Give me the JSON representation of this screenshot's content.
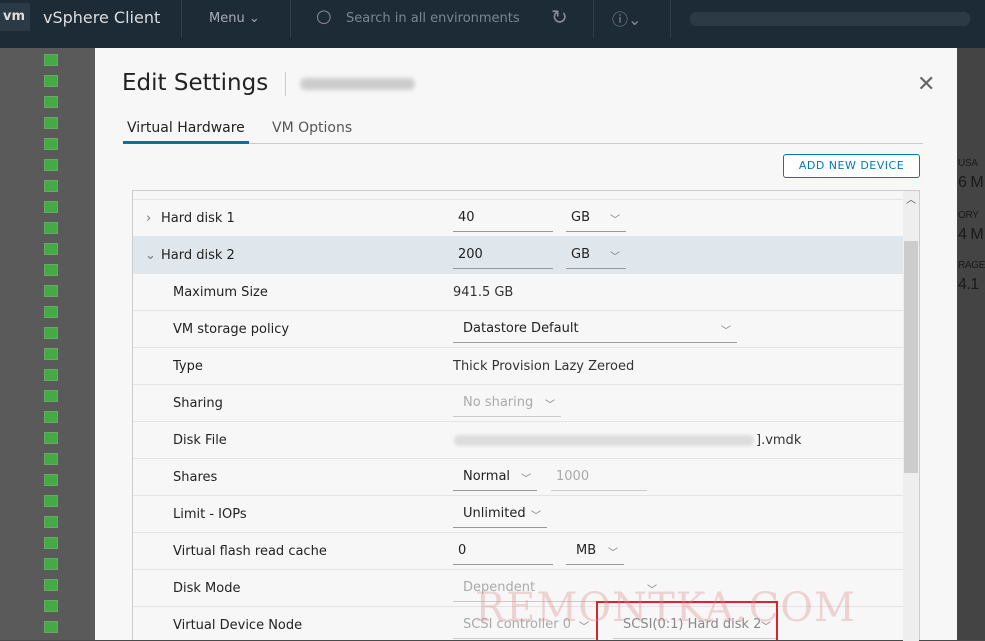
{
  "header": {
    "logo": "vm",
    "app_title": "vSphere Client",
    "menu_label": "Menu",
    "search_placeholder": "Search in all environments"
  },
  "background": {
    "usage_label": "USA",
    "usage_value": "6 M",
    "memory_label": "ORY",
    "memory_value": "4 M",
    "storage_label": "RAGE",
    "storage_value": "4.1"
  },
  "dialog": {
    "title": "Edit Settings",
    "tabs": [
      {
        "label": "Virtual Hardware"
      },
      {
        "label": "VM Options"
      }
    ],
    "add_device_label": "ADD NEW DEVICE",
    "hard_disk_1": {
      "label": "Hard disk 1",
      "size": "40",
      "unit": "GB"
    },
    "hard_disk_2": {
      "label": "Hard disk 2",
      "size": "200",
      "unit": "GB",
      "max_size_label": "Maximum Size",
      "max_size": "941.5 GB",
      "policy_label": "VM storage policy",
      "policy": "Datastore Default",
      "type_label": "Type",
      "type": "Thick Provision Lazy Zeroed",
      "sharing_label": "Sharing",
      "sharing": "No sharing",
      "disk_file_label": "Disk File",
      "disk_file_suffix": "].vmdk",
      "shares_label": "Shares",
      "shares": "Normal",
      "shares_value": "1000",
      "limit_label": "Limit - IOPs",
      "limit": "Unlimited",
      "flash_label": "Virtual flash read cache",
      "flash_value": "0",
      "flash_unit": "MB",
      "mode_label": "Disk Mode",
      "mode": "Dependent",
      "node_label": "Virtual Device Node",
      "controller": "SCSI controller 0",
      "node": "SCSI(0:1) Hard disk 2"
    }
  },
  "watermark": "REMONTKA.COM",
  "colors": {
    "accent": "#0079b8",
    "highlight": "#e0202a"
  }
}
